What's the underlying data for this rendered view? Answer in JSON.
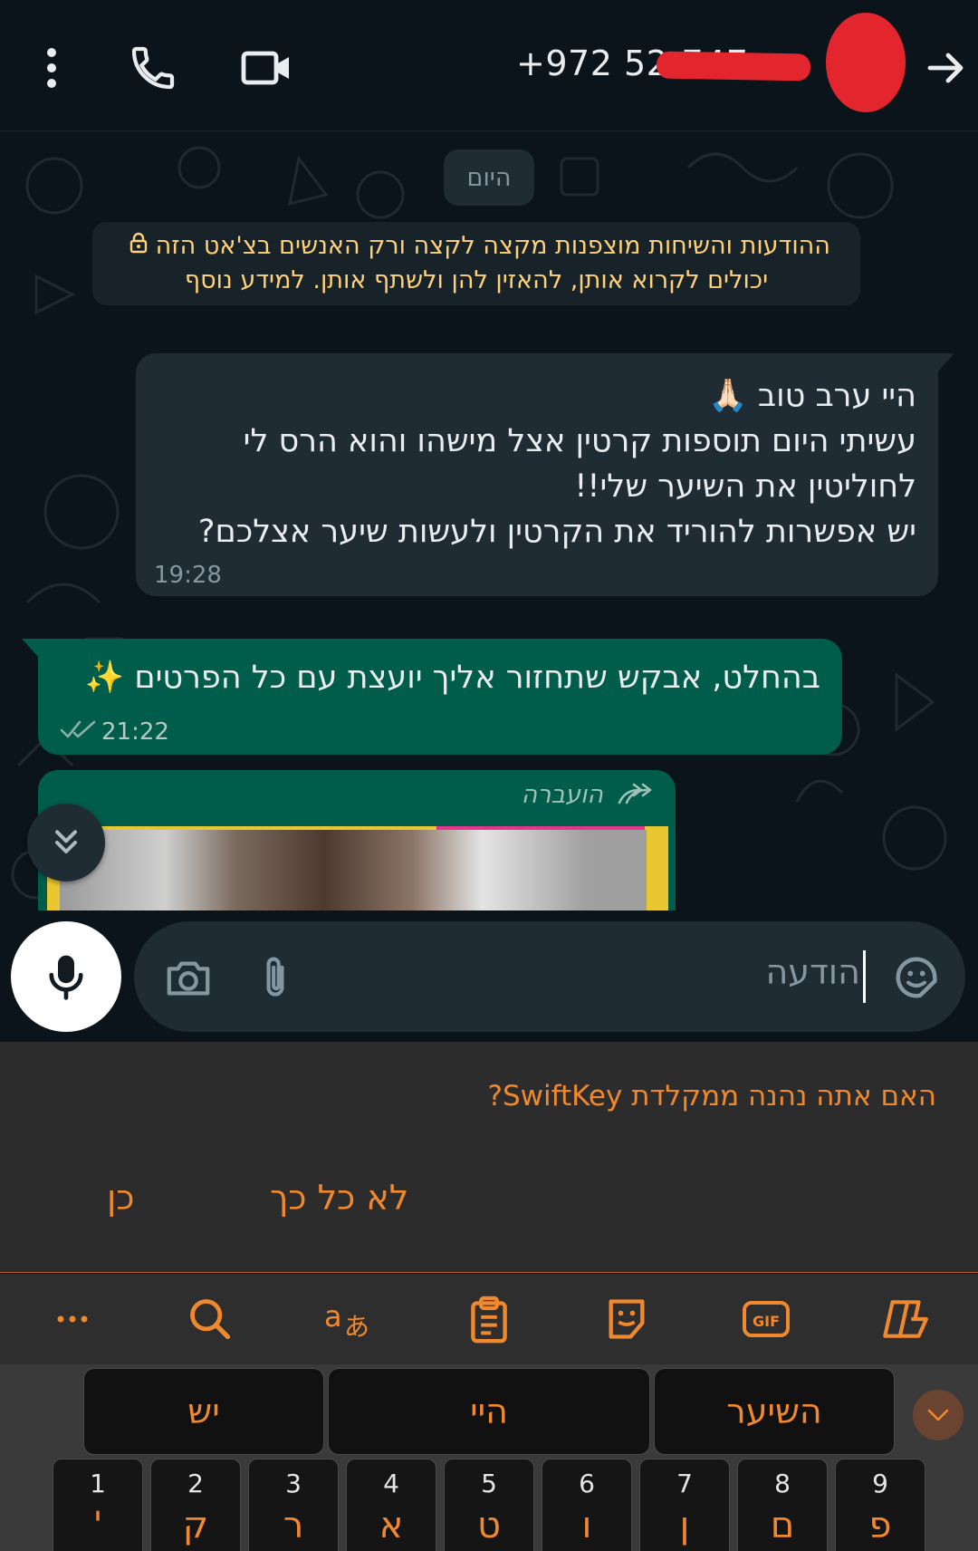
{
  "header": {
    "contact_number": "+972 52-747",
    "icons": [
      "back-arrow-icon",
      "avatar",
      "video-call-icon",
      "voice-call-icon",
      "more-options-icon"
    ]
  },
  "chat": {
    "date_label": "היום",
    "encryption_notice": {
      "line1": "ההודעות והשיחות מוצפנות מקצה לקצה ורק האנשים בצ'אט הזה",
      "line2": "יכולים לקרוא אותן, להאזין להן ולשתף אותן. למידע נוסף"
    },
    "incoming": {
      "lines": [
        "היי ערב טוב 🙏🏻",
        "עשיתי היום תוספות קרטין אצל מישהו והוא הרס לי",
        "לחוליטין את השיער שלי!!",
        "יש אפשרות להוריד את הקרטין ולעשות שיער אצלכם?"
      ],
      "time": "19:28"
    },
    "outgoing": {
      "text": "בהחלט, אבקש שתחזור אליך יועצת עם כל הפרטים ✨",
      "time": "21:22",
      "status": "read"
    },
    "forwarded": {
      "label": "הועברה"
    }
  },
  "input": {
    "placeholder": "הודעה"
  },
  "keyboard": {
    "prompt": {
      "question": "האם אתה נהנה ממקלדת SwiftKey?",
      "yes": "כן",
      "no": "לא כל כך"
    },
    "toolbar_icons": [
      "copilot-icon",
      "gif-icon",
      "sticker-icon",
      "clipboard-icon",
      "translate-icon",
      "search-icon",
      "more-icon"
    ],
    "suggestions": [
      "השיער",
      "היי",
      "יש"
    ],
    "keys": [
      {
        "num": "1",
        "ch": "'"
      },
      {
        "num": "2",
        "ch": "ק"
      },
      {
        "num": "3",
        "ch": "ר"
      },
      {
        "num": "4",
        "ch": "א"
      },
      {
        "num": "5",
        "ch": "ט"
      },
      {
        "num": "6",
        "ch": "ו"
      },
      {
        "num": "7",
        "ch": "ן"
      },
      {
        "num": "8",
        "ch": "ם"
      },
      {
        "num": "9",
        "ch": "פ"
      }
    ]
  },
  "colors": {
    "background": "#0b141a",
    "incoming_bubble": "#1f2c34",
    "outgoing_bubble": "#005c4b",
    "notice_text": "#ffd279",
    "keyboard_accent": "#f0882e"
  }
}
